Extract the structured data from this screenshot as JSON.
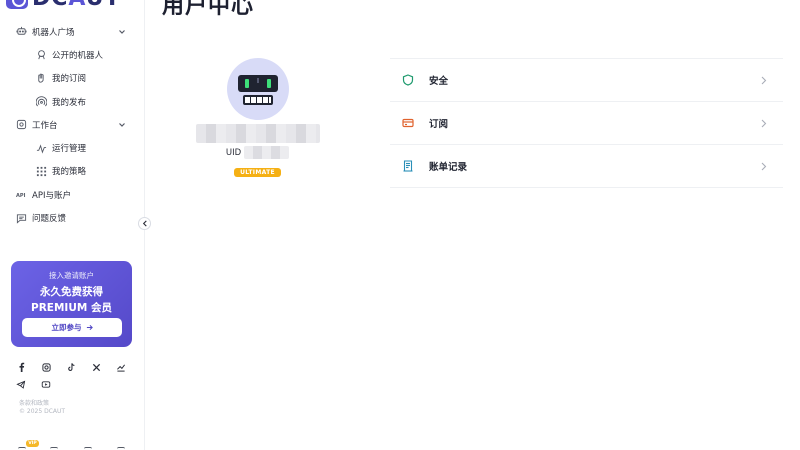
{
  "brand": {
    "name_prefix": "DC",
    "name_accent": "A",
    "name_suffix": "UT"
  },
  "sidebar": {
    "items": [
      {
        "label": "机器人广场",
        "icon": "robot-icon",
        "expandable": true
      },
      {
        "label": "公开的机器人",
        "icon": "robot-head-icon",
        "sub": true
      },
      {
        "label": "我的订阅",
        "icon": "hand-icon",
        "sub": true
      },
      {
        "label": "我的发布",
        "icon": "broadcast-icon",
        "sub": true
      },
      {
        "label": "工作台",
        "icon": "gear-icon",
        "expandable": true
      },
      {
        "label": "运行管理",
        "icon": "pulse-icon",
        "sub": true
      },
      {
        "label": "我的策略",
        "icon": "grid-icon",
        "sub": true
      },
      {
        "label": "API与账户",
        "icon": "api-icon"
      },
      {
        "label": "问题反馈",
        "icon": "chat-icon"
      }
    ]
  },
  "promo": {
    "subtitle": "接入邀请账户",
    "title_line1": "永久免费获得",
    "title_line2": "PREMIUM 会员",
    "button_label": "立即参与",
    "button_icon": "arrow-right-icon"
  },
  "socials": [
    "facebook-icon",
    "instagram-icon",
    "tiktok-icon",
    "x-icon",
    "chart-icon",
    "telegram-icon",
    "youtube-icon"
  ],
  "footer": {
    "link": "条款和政策",
    "copyright": "© 2025 DCAUT"
  },
  "bottom": {
    "vip_badge": "VIP"
  },
  "page": {
    "title": "用户中心"
  },
  "profile": {
    "uid_label": "UID",
    "tier": "ULTIMATE"
  },
  "menu": [
    {
      "label": "安全",
      "icon": "shield-icon",
      "color": "#1f9a6e"
    },
    {
      "label": "订阅",
      "icon": "card-icon",
      "color": "#e0622d"
    },
    {
      "label": "账单记录",
      "icon": "receipt-icon",
      "color": "#2a8fb8"
    }
  ],
  "colors": {
    "accent": "#5b55d6",
    "gold": "#f5b014"
  }
}
